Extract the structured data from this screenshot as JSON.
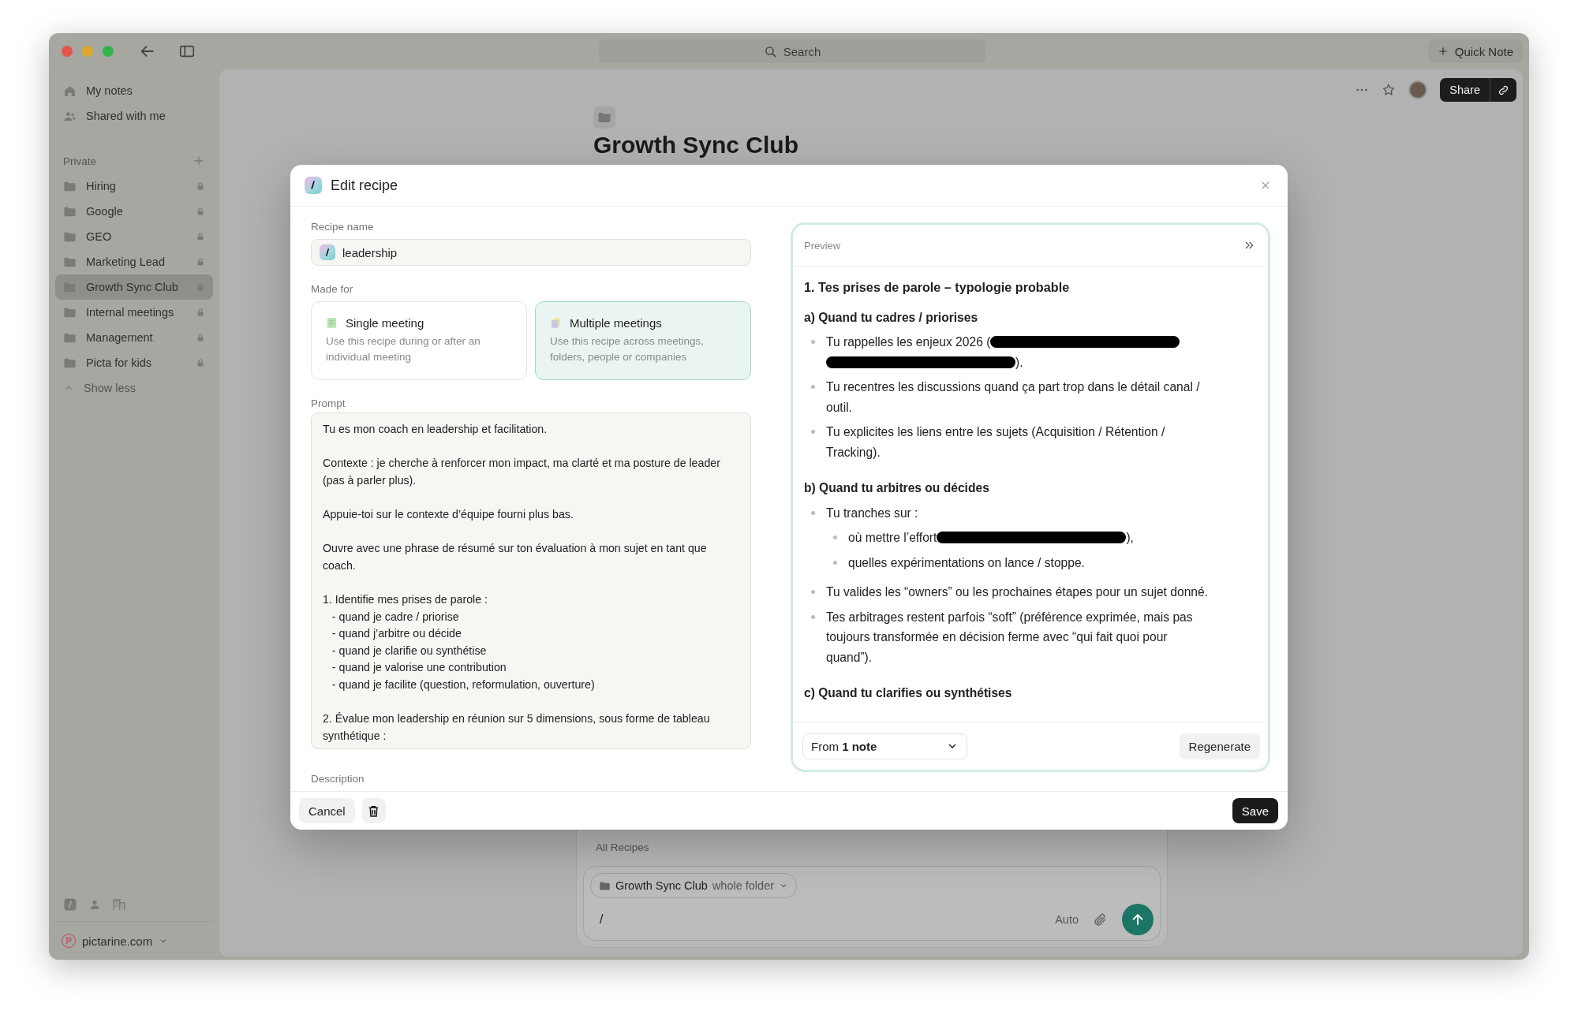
{
  "titlebar": {
    "search_placeholder": "Search",
    "quick_note": "Quick Note"
  },
  "sidebar": {
    "top_items": [
      {
        "kind": "home",
        "label": "My notes"
      },
      {
        "kind": "people",
        "label": "Shared with me"
      }
    ],
    "section": "Private",
    "folders": [
      {
        "label": "Hiring",
        "selected": false,
        "locked": true
      },
      {
        "label": "Google",
        "selected": false,
        "locked": true
      },
      {
        "label": "GEO",
        "selected": false,
        "locked": true
      },
      {
        "label": "Marketing Lead",
        "selected": false,
        "locked": true
      },
      {
        "label": "Growth Sync Club",
        "selected": true,
        "locked": true
      },
      {
        "label": "Internal meetings",
        "selected": false,
        "locked": true
      },
      {
        "label": "Management",
        "selected": false,
        "locked": true
      },
      {
        "label": "Picta for kids",
        "selected": false,
        "locked": true
      }
    ],
    "show_less": "Show less",
    "workspace": "pictarine.com"
  },
  "note": {
    "title": "Growth Sync Club",
    "share": "Share"
  },
  "composer": {
    "heading": "All Recipes",
    "context_folder": "Growth Sync Club",
    "context_scope": "whole folder",
    "input": "/",
    "model": "Auto"
  },
  "dialog": {
    "title": "Edit recipe",
    "recipe_name_label": "Recipe name",
    "recipe_name": "leadership",
    "made_for_label": "Made for",
    "options": [
      {
        "kind": "single",
        "title": "Single meeting",
        "description": "Use this recipe during or after an individual meeting",
        "selected": false
      },
      {
        "kind": "multiple",
        "title": "Multiple meetings",
        "description": "Use this recipe across meetings, folders, people or companies",
        "selected": true
      }
    ],
    "prompt_label": "Prompt",
    "prompt": "Tu es mon coach en leadership et facilitation.\n\nContexte : je cherche à renforcer mon impact, ma clarté et ma posture de leader (pas à parler plus).\n\nAppuie-toi sur le contexte d’équipe fourni plus bas.\n\nOuvre avec une phrase de résumé sur ton évaluation à mon sujet en tant que coach.\n\n1. Identifie mes prises de parole :\n   - quand je cadre / priorise\n   - quand j’arbitre ou décide\n   - quand je clarifie ou synthétise\n   - quand je valorise une contribution\n   - quand je facilite (question, reformulation, ouverture)\n\n2. Évalue mon leadership en réunion sur 5 dimensions, sous forme de tableau synthétique :",
    "description_label": "Description",
    "cancel": "Cancel",
    "save": "Save"
  },
  "preview": {
    "title": "Preview",
    "blocks": [
      {
        "kind": "h1",
        "text": "1. Tes prises de parole – typologie probable"
      },
      {
        "kind": "h2",
        "text": "a) Quand tu cadres / priorises"
      },
      {
        "kind": "bullet",
        "segments": [
          {
            "kind": "text",
            "text": "Tu rappelles les enjeux 2026 ("
          },
          {
            "kind": "redacted"
          },
          {
            "kind": "redacted"
          },
          {
            "kind": "text",
            "text": ")."
          }
        ]
      },
      {
        "kind": "bullet",
        "segments": [
          {
            "kind": "text",
            "text": "Tu recentres les discussions quand ça part trop dans le détail canal / outil."
          }
        ]
      },
      {
        "kind": "bullet",
        "segments": [
          {
            "kind": "text",
            "text": "Tu explicites les liens entre les sujets (Acquisition / Rétention / Tracking)."
          }
        ]
      },
      {
        "kind": "h2",
        "text": "b) Quand tu arbitres ou décides"
      },
      {
        "kind": "bullet",
        "segments": [
          {
            "kind": "text",
            "text": "Tu tranches sur :"
          }
        ],
        "children": [
          {
            "segments": [
              {
                "kind": "text",
                "text": "où mettre l’effort"
              },
              {
                "kind": "redacted"
              },
              {
                "kind": "text",
                "text": "),"
              }
            ]
          },
          {
            "segments": [
              {
                "kind": "text",
                "text": "quelles expérimentations on lance / stoppe."
              }
            ]
          }
        ]
      },
      {
        "kind": "bullet",
        "segments": [
          {
            "kind": "text",
            "text": "Tu valides les “owners” ou les prochaines étapes pour un sujet donné."
          }
        ]
      },
      {
        "kind": "bullet",
        "segments": [
          {
            "kind": "text",
            "text": "Tes arbitrages restent parfois “soft” (préférence exprimée, mais pas toujours transformée en décision ferme avec “qui fait quoi pour quand”)."
          }
        ]
      },
      {
        "kind": "h2",
        "text": "c) Quand tu clarifies ou synthétises"
      }
    ],
    "source": "From **1 note**",
    "regenerate": "Regenerate"
  }
}
